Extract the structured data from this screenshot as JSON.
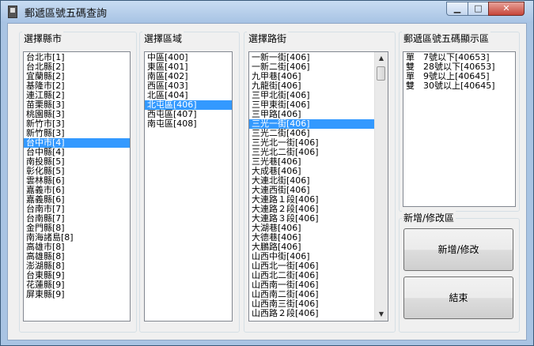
{
  "window": {
    "title": "郵遞區號五碼查詢",
    "min_glyph": "▁",
    "max_glyph": "□",
    "close_glyph": "✕"
  },
  "county_panel": {
    "label": "選擇縣市",
    "items": [
      "台北市[1]",
      "台北縣[2]",
      "宜蘭縣[2]",
      "基隆市[2]",
      "連江縣[2]",
      "苗栗縣[3]",
      "桃園縣[3]",
      "新竹市[3]",
      "新竹縣[3]",
      "台中市[4]",
      "台中縣[4]",
      "南投縣[5]",
      "彰化縣[5]",
      "雲林縣[6]",
      "嘉義市[6]",
      "嘉義縣[6]",
      "台南市[7]",
      "台南縣[7]",
      "金門縣[8]",
      "南海諸島[8]",
      "高雄市[8]",
      "高雄縣[8]",
      "澎湖縣[8]",
      "台東縣[9]",
      "花蓮縣[9]",
      "屏東縣[9]"
    ],
    "selected_index": 9
  },
  "district_panel": {
    "label": "選擇區域",
    "items": [
      "中區[400]",
      "東區[401]",
      "南區[402]",
      "西區[403]",
      "北區[404]",
      "北屯區[406]",
      "西屯區[407]",
      "南屯區[408]"
    ],
    "selected_index": 5
  },
  "road_panel": {
    "label": "選擇路街",
    "items": [
      "一新一街[406]",
      "一新二街[406]",
      "九甲巷[406]",
      "九龍街[406]",
      "三甲北街[406]",
      "三甲東街[406]",
      "三甲路[406]",
      "三光一街[406]",
      "三光二街[406]",
      "三光北一街[406]",
      "三光北二街[406]",
      "三光巷[406]",
      "大成巷[406]",
      "大連北街[406]",
      "大連西街[406]",
      "大連路１段[406]",
      "大連路２段[406]",
      "大連路３段[406]",
      "大湖巷[406]",
      "大德巷[406]",
      "大鵬路[406]",
      "山西中街[406]",
      "山西北一街[406]",
      "山西北二街[406]",
      "山西南一街[406]",
      "山西南二街[406]",
      "山西南三街[406]",
      "山西路２段[406]"
    ],
    "selected_index": 7,
    "scroll_up": "▲",
    "scroll_down": "▼"
  },
  "result_panel": {
    "label": "郵遞區號五碼顯示區",
    "lines": [
      "單　7號以下[40653]",
      "雙　28號以下[40653]",
      "單　9號以上[40645]",
      "雙　30號以上[40645]"
    ]
  },
  "edit_panel": {
    "label": "新增/修改區",
    "add_edit_button": "新增/修改",
    "exit_button": "結束"
  }
}
